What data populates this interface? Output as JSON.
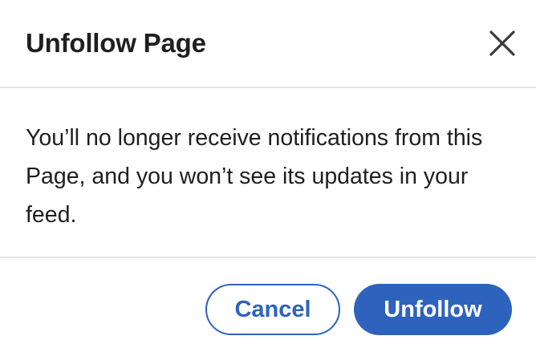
{
  "dialog": {
    "title": "Unfollow Page",
    "close_icon": "close-icon",
    "message": "You’ll no longer receive notifications from this Page, and you won’t see its updates in your feed.",
    "cancel_label": "Cancel",
    "confirm_label": "Unfollow"
  },
  "colors": {
    "accent": "#2e63bd",
    "text": "#1f1f1f",
    "divider": "#e6e6e6"
  }
}
